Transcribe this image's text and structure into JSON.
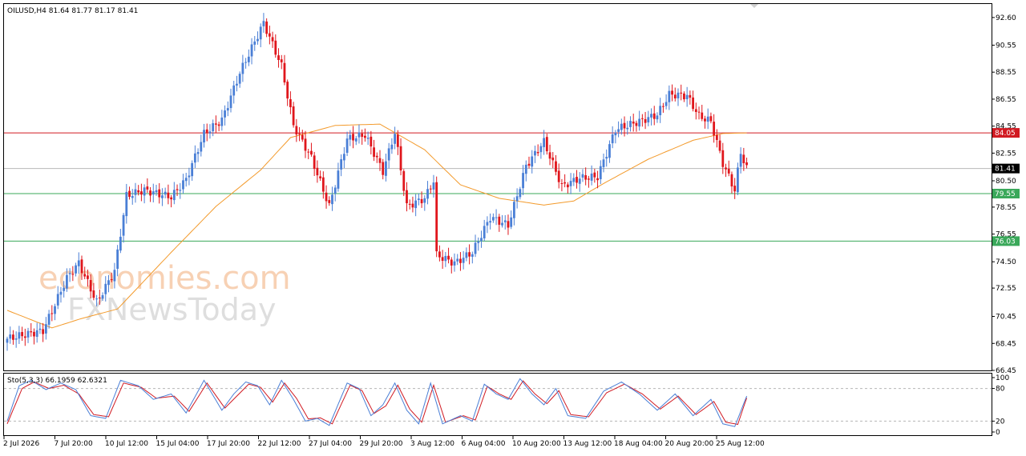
{
  "header": {
    "main_title": "OILUSD,H4  81.64 81.77 81.17 81.41",
    "stoch_title": "Sto(5,3,3) 66.1959 62.6321"
  },
  "watermark": {
    "line1": "economies.com",
    "line2": "FXNewsToday"
  },
  "colors": {
    "bull": "#4a7fd6",
    "bear": "#e0161c",
    "ma": "#f39a2b",
    "resistance": "#d11a22",
    "support": "#3aa85a",
    "current": "#b8b8b8",
    "stoch_main": "#4a7fd6",
    "stoch_signal": "#d11a22"
  },
  "chart_data": [
    {
      "type": "candlestick",
      "title": "OILUSD,H4  81.64 81.77 81.17 81.41",
      "ylim": [
        66.45,
        93.6
      ],
      "y_ticks": [
        "92.60",
        "90.55",
        "88.55",
        "86.55",
        "84.55",
        "82.55",
        "80.50",
        "78.55",
        "76.55",
        "74.50",
        "72.55",
        "70.45",
        "68.45",
        "66.45"
      ],
      "x_ticks": [
        "2 Jul 2026",
        "7 Jul 20:00",
        "10 Jul 12:00",
        "15 Jul 04:00",
        "17 Jul 20:00",
        "22 Jul 12:00",
        "27 Jul 04:00",
        "29 Jul 20:00",
        "3 Aug 12:00",
        "6 Aug 04:00",
        "10 Aug 20:00",
        "13 Aug 12:00",
        "18 Aug 04:00",
        "20 Aug 20:00",
        "25 Aug 12:00"
      ],
      "anchors": [
        [
          0,
          68.8
        ],
        [
          6,
          69.1
        ],
        [
          12,
          69.4
        ],
        [
          20,
          73.3
        ],
        [
          24,
          74.4
        ],
        [
          30,
          71.5
        ],
        [
          36,
          73.8
        ],
        [
          40,
          79.4
        ],
        [
          46,
          79.8
        ],
        [
          55,
          79.3
        ],
        [
          60,
          80.6
        ],
        [
          66,
          84.0
        ],
        [
          72,
          85.0
        ],
        [
          78,
          88.5
        ],
        [
          86,
          92.2
        ],
        [
          92,
          89.0
        ],
        [
          96,
          84.6
        ],
        [
          102,
          82.2
        ],
        [
          108,
          78.6
        ],
        [
          114,
          83.6
        ],
        [
          120,
          83.9
        ],
        [
          126,
          81.2
        ],
        [
          130,
          84.1
        ],
        [
          134,
          78.6
        ],
        [
          140,
          79.2
        ],
        [
          143,
          80.5
        ],
        [
          144,
          75.0
        ],
        [
          150,
          74.4
        ],
        [
          156,
          75.2
        ],
        [
          162,
          77.8
        ],
        [
          168,
          77.2
        ],
        [
          174,
          81.6
        ],
        [
          180,
          83.4
        ],
        [
          186,
          80.1
        ],
        [
          192,
          80.7
        ],
        [
          198,
          80.8
        ],
        [
          204,
          84.3
        ],
        [
          212,
          84.9
        ],
        [
          218,
          85.4
        ],
        [
          222,
          86.9
        ],
        [
          228,
          86.8
        ],
        [
          232,
          85.3
        ],
        [
          236,
          84.9
        ],
        [
          240,
          81.8
        ],
        [
          244,
          79.8
        ],
        [
          246,
          82.6
        ],
        [
          248,
          81.41
        ]
      ],
      "current_price": "81.41",
      "levels": [
        {
          "value": 84.05,
          "label": "84.05",
          "role": "resistance"
        },
        {
          "value": 79.55,
          "label": "79.55",
          "role": "support"
        },
        {
          "value": 76.03,
          "label": "76.03",
          "role": "support"
        }
      ],
      "ma": [
        [
          0,
          70.9
        ],
        [
          15,
          69.6
        ],
        [
          25,
          70.3
        ],
        [
          37,
          71.0
        ],
        [
          55,
          75.2
        ],
        [
          70,
          78.6
        ],
        [
          85,
          81.3
        ],
        [
          95,
          83.7
        ],
        [
          110,
          84.6
        ],
        [
          125,
          84.7
        ],
        [
          140,
          82.8
        ],
        [
          152,
          80.2
        ],
        [
          165,
          79.2
        ],
        [
          180,
          78.7
        ],
        [
          190,
          79.0
        ],
        [
          200,
          80.3
        ],
        [
          215,
          82.1
        ],
        [
          230,
          83.5
        ],
        [
          240,
          84.0
        ],
        [
          248,
          84.05
        ]
      ]
    },
    {
      "type": "line",
      "title": "Sto(5,3,3) 66.1959 62.6321",
      "ylim": [
        0,
        100
      ],
      "y_ticks": [
        "100",
        "80",
        "20",
        "0"
      ],
      "levels": [
        80,
        20
      ],
      "main_anchors": [
        [
          0,
          20
        ],
        [
          4,
          85
        ],
        [
          8,
          95
        ],
        [
          13,
          78
        ],
        [
          18,
          90
        ],
        [
          23,
          78
        ],
        [
          28,
          30
        ],
        [
          33,
          25
        ],
        [
          38,
          95
        ],
        [
          44,
          85
        ],
        [
          49,
          60
        ],
        [
          55,
          70
        ],
        [
          60,
          35
        ],
        [
          66,
          95
        ],
        [
          72,
          40
        ],
        [
          76,
          70
        ],
        [
          80,
          92
        ],
        [
          84,
          85
        ],
        [
          88,
          50
        ],
        [
          92,
          95
        ],
        [
          96,
          60
        ],
        [
          100,
          20
        ],
        [
          104,
          25
        ],
        [
          108,
          12
        ],
        [
          114,
          90
        ],
        [
          118,
          80
        ],
        [
          122,
          30
        ],
        [
          126,
          50
        ],
        [
          130,
          90
        ],
        [
          134,
          40
        ],
        [
          138,
          15
        ],
        [
          142,
          90
        ],
        [
          146,
          15
        ],
        [
          152,
          30
        ],
        [
          156,
          20
        ],
        [
          160,
          88
        ],
        [
          164,
          70
        ],
        [
          168,
          60
        ],
        [
          172,
          98
        ],
        [
          176,
          70
        ],
        [
          180,
          50
        ],
        [
          184,
          80
        ],
        [
          188,
          30
        ],
        [
          194,
          25
        ],
        [
          200,
          75
        ],
        [
          206,
          92
        ],
        [
          212,
          70
        ],
        [
          218,
          40
        ],
        [
          224,
          70
        ],
        [
          230,
          30
        ],
        [
          236,
          60
        ],
        [
          240,
          15
        ],
        [
          244,
          10
        ],
        [
          248,
          66
        ]
      ],
      "signal_anchors": [
        [
          0,
          15
        ],
        [
          5,
          80
        ],
        [
          9,
          92
        ],
        [
          14,
          80
        ],
        [
          19,
          86
        ],
        [
          24,
          70
        ],
        [
          29,
          32
        ],
        [
          34,
          28
        ],
        [
          39,
          90
        ],
        [
          45,
          82
        ],
        [
          50,
          62
        ],
        [
          56,
          66
        ],
        [
          61,
          38
        ],
        [
          67,
          90
        ],
        [
          73,
          44
        ],
        [
          77,
          66
        ],
        [
          81,
          88
        ],
        [
          85,
          82
        ],
        [
          89,
          55
        ],
        [
          93,
          90
        ],
        [
          97,
          62
        ],
        [
          101,
          24
        ],
        [
          105,
          26
        ],
        [
          109,
          15
        ],
        [
          115,
          86
        ],
        [
          119,
          76
        ],
        [
          123,
          34
        ],
        [
          127,
          48
        ],
        [
          131,
          86
        ],
        [
          135,
          42
        ],
        [
          139,
          18
        ],
        [
          143,
          86
        ],
        [
          147,
          18
        ],
        [
          153,
          30
        ],
        [
          157,
          22
        ],
        [
          161,
          84
        ],
        [
          165,
          70
        ],
        [
          169,
          60
        ],
        [
          173,
          94
        ],
        [
          177,
          70
        ],
        [
          181,
          52
        ],
        [
          185,
          76
        ],
        [
          189,
          32
        ],
        [
          195,
          28
        ],
        [
          201,
          72
        ],
        [
          207,
          88
        ],
        [
          213,
          70
        ],
        [
          219,
          42
        ],
        [
          225,
          66
        ],
        [
          231,
          32
        ],
        [
          237,
          56
        ],
        [
          241,
          18
        ],
        [
          245,
          14
        ],
        [
          248,
          62.6
        ]
      ]
    }
  ]
}
